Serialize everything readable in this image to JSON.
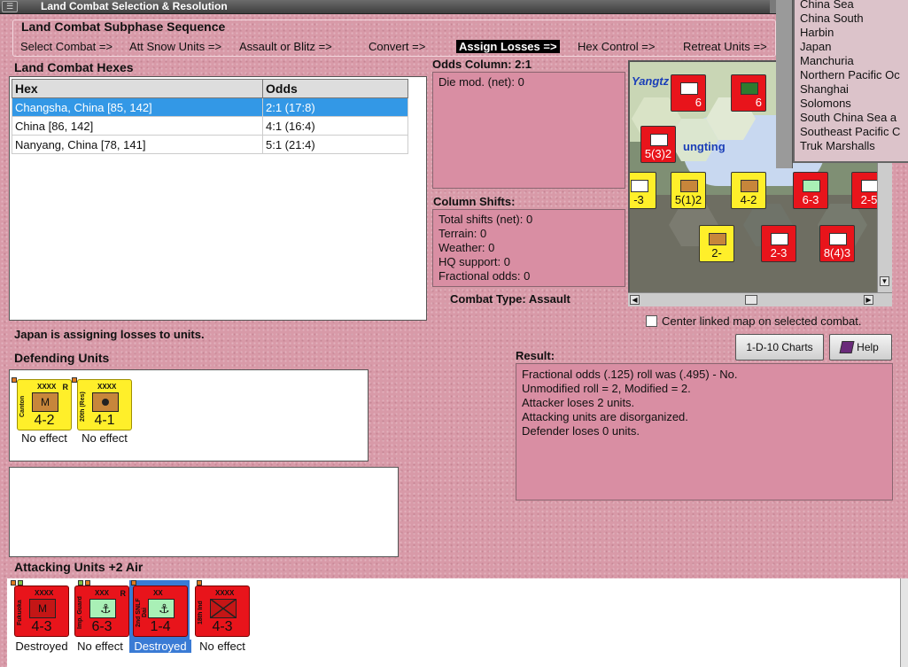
{
  "window": {
    "title": "Land Combat Selection & Resolution"
  },
  "sequence": {
    "title": "Land Combat Subphase Sequence",
    "steps": [
      {
        "label": "Select Combat =>",
        "active": false
      },
      {
        "label": "Att Snow Units =>",
        "active": false
      },
      {
        "label": "Assault or Blitz =>",
        "active": false
      },
      {
        "label": "Convert =>",
        "active": false
      },
      {
        "label": "Assign Losses =>",
        "active": true
      },
      {
        "label": "Hex Control =>",
        "active": false
      },
      {
        "label": "Retreat Units =>",
        "active": false
      }
    ]
  },
  "hexes": {
    "label": "Land Combat Hexes",
    "columns": [
      "Hex",
      "Odds"
    ],
    "rows": [
      {
        "hex": "Changsha, China [85, 142]",
        "odds": "2:1 (17:8)",
        "selected": true
      },
      {
        "hex": "China [86, 142]",
        "odds": "4:1 (16:4)",
        "selected": false
      },
      {
        "hex": "Nanyang, China [78, 141]",
        "odds": "5:1 (21:4)",
        "selected": false
      }
    ]
  },
  "odds": {
    "label": "Odds Column: 2:1",
    "die_mod": "Die mod. (net): 0"
  },
  "shifts": {
    "label": "Column Shifts:",
    "lines": [
      "Total shifts (net): 0",
      "Terrain: 0",
      "Weather: 0",
      "HQ support: 0",
      "Fractional odds: 0"
    ]
  },
  "combat_type": "Combat Type:  Assault",
  "status_message": "Japan is assigning losses to units.",
  "regions": [
    "China Sea",
    "China South",
    "Harbin",
    "Japan",
    "Manchuria",
    "Northern Pacific Oc",
    "Shanghai",
    "Solomons",
    "South China Sea a",
    "Southeast Pacific C",
    "Truk Marshalls"
  ],
  "map": {
    "labels": [
      "Yangtz",
      "ungting"
    ],
    "counters": [
      {
        "text": "5(3)2",
        "color": "red"
      },
      {
        "text": "5(1)2",
        "color": "yellow"
      },
      {
        "text": "4-2",
        "color": "yellow"
      },
      {
        "text": "6-3",
        "color": "red"
      },
      {
        "text": "2-",
        "color": "yellow"
      },
      {
        "text": "2-3",
        "color": "red"
      },
      {
        "text": "8(4)3",
        "color": "red"
      },
      {
        "text": "6",
        "color": "red"
      },
      {
        "text": "6",
        "color": "red"
      },
      {
        "text": "-3",
        "color": "yellow"
      },
      {
        "text": "2-5",
        "color": "red"
      }
    ]
  },
  "center_map": {
    "label": "Center linked map on selected combat.",
    "checked": false
  },
  "buttons": {
    "charts": "1-D-10 Charts",
    "help": "Help"
  },
  "result": {
    "label": "Result:",
    "lines": [
      "Fractional odds (.125) roll was (.495)  - No.",
      "Unmodified roll = 2, Modified = 2.",
      "Attacker loses 2 units.",
      "Attacking units are disorganized.",
      "Defender loses 0 units."
    ]
  },
  "defending": {
    "label": "Defending Units",
    "units": [
      {
        "name": "Canton",
        "size": "XXXX",
        "corner": "R",
        "strength": "4-2",
        "status": "No effect",
        "color": "yellow",
        "symbol": "M"
      },
      {
        "name": "20th (Res)",
        "size": "XXXX",
        "corner": "",
        "strength": "4-1",
        "status": "No effect",
        "color": "yellow",
        "symbol": ""
      }
    ]
  },
  "attacking": {
    "label": "Attacking Units +2 Air",
    "units": [
      {
        "name": "Fukuoka",
        "size": "XXXX",
        "corner": "",
        "strength": "4-3",
        "status": "Destroyed",
        "color": "red",
        "symbol": "M",
        "selected": false
      },
      {
        "name": "Imp. Guard",
        "size": "XXX",
        "corner": "R",
        "strength": "6-3",
        "status": "No effect",
        "color": "red",
        "symbol": "",
        "selected": false
      },
      {
        "name": "2nd SNLF Dai",
        "size": "XX",
        "corner": "",
        "strength": "1-4",
        "status": "Destroyed",
        "color": "red",
        "symbol": "",
        "selected": true
      },
      {
        "name": "18th Ind",
        "size": "XXXX",
        "corner": "",
        "strength": "4-3",
        "status": "No effect",
        "color": "red",
        "symbol": "",
        "selected": false
      }
    ]
  },
  "colors": {
    "panel_pink": "#d98ea3",
    "selection_blue": "#3398e6",
    "japan_red": "#e8141b",
    "china_yellow": "#ffef2a"
  }
}
